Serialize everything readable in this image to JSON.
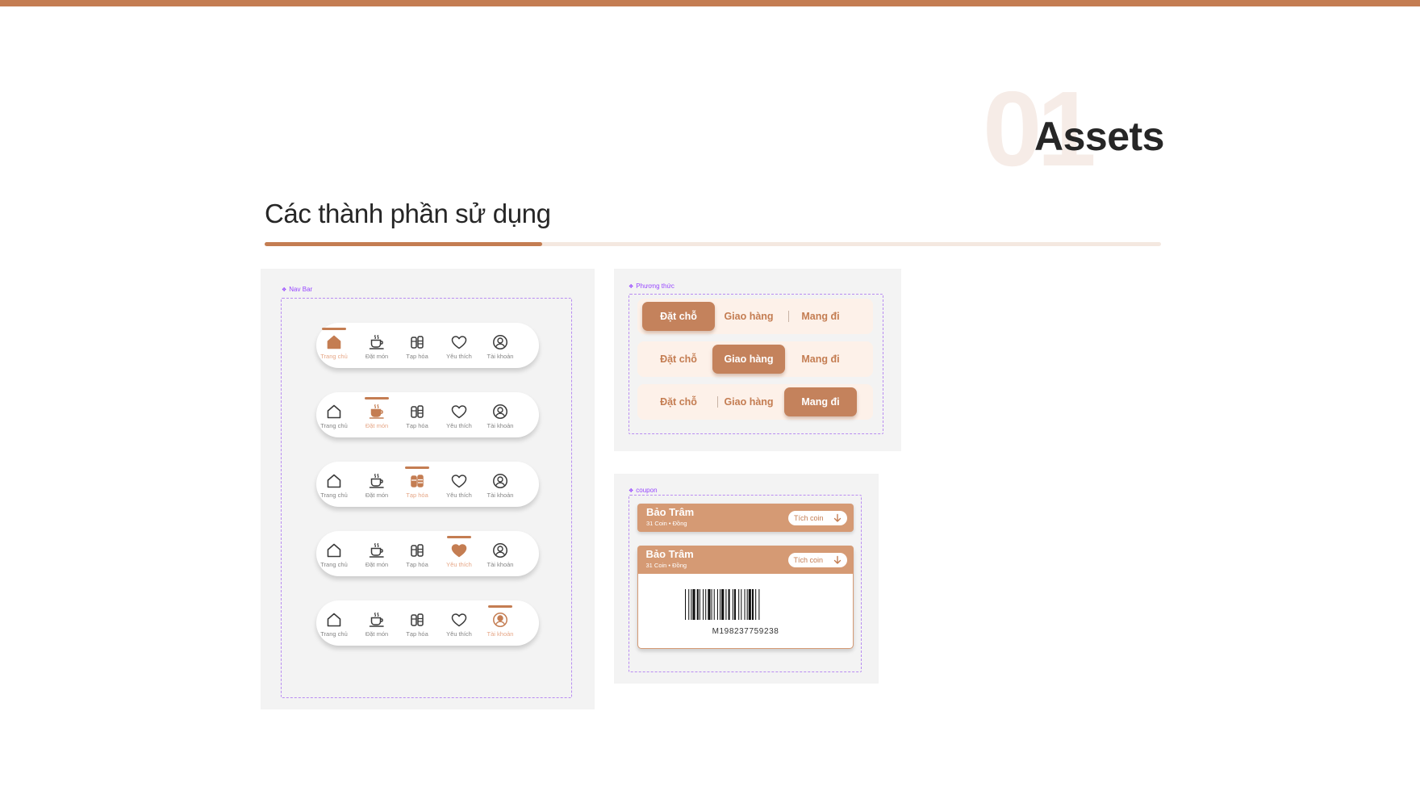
{
  "slide": {
    "section_number": "01",
    "section_title": "Assets",
    "heading": "Các thành phần sử dụng",
    "progress": 0.31
  },
  "colors": {
    "accent": "#c47d52",
    "accent_light": "#e6a787",
    "coupon_bar": "#d59a74",
    "segment_bg": "#fdf1e9",
    "frame_dash": "#b98cf2"
  },
  "navbar_panel": {
    "label": "Nav Bar",
    "items": [
      {
        "label": "Trang chủ",
        "icon": "home-icon"
      },
      {
        "label": "Đặt món",
        "icon": "coffee-cup-icon"
      },
      {
        "label": "Tạp hóa",
        "icon": "grocery-bottles-icon"
      },
      {
        "label": "Yêu thích",
        "icon": "heart-icon"
      },
      {
        "label": "Tài khoản",
        "icon": "account-icon"
      }
    ],
    "variants": [
      {
        "active": 0
      },
      {
        "active": 1
      },
      {
        "active": 2
      },
      {
        "active": 3
      },
      {
        "active": 4
      }
    ]
  },
  "method_panel": {
    "label": "Phương thức",
    "options": [
      "Đặt chỗ",
      "Giao hàng",
      "Mang đi"
    ],
    "variants": [
      {
        "active": 0
      },
      {
        "active": 1
      },
      {
        "active": 2
      }
    ]
  },
  "coupon_panel": {
    "label": "coupon",
    "name": "Bảo Trâm",
    "subtitle": "31 Coin • Đồng",
    "action_label": "Tích coin",
    "action_icon": "arrow-down-icon",
    "barcode_number": "M198237759238"
  }
}
